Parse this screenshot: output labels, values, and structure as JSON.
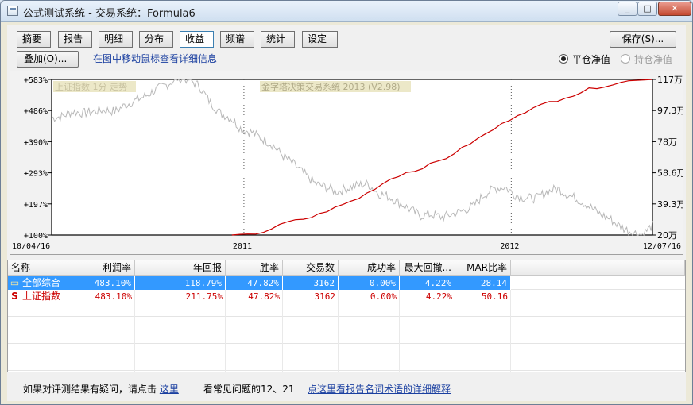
{
  "window": {
    "title": "公式测试系统 - 交易系统：Formula6",
    "min": "_",
    "max": "□",
    "close": "✕"
  },
  "tabs": [
    {
      "label": "摘要",
      "active": false
    },
    {
      "label": "报告",
      "active": false
    },
    {
      "label": "明细",
      "active": false
    },
    {
      "label": "分布",
      "active": false
    },
    {
      "label": "收益",
      "active": true
    },
    {
      "label": "频谱",
      "active": false
    },
    {
      "label": "统计",
      "active": false
    },
    {
      "label": "设定",
      "active": false
    }
  ],
  "toolbar": {
    "save_label": "保存(S)...",
    "overlay_label": "叠加(O)...",
    "hint": "在图中移动鼠标查看详细信息"
  },
  "mode": {
    "option1": "平仓净值",
    "option2": "持仓净值",
    "selected": "平仓净值"
  },
  "chart_data": {
    "type": "line",
    "watermark_left": "上证指数 1分 走势",
    "watermark_center": "金字塔决策交易系统 2013 (V2.98)",
    "left_ticks": [
      "+583%",
      "+486%",
      "+390%",
      "+293%",
      "+197%",
      "+100%"
    ],
    "right_ticks": [
      "117万",
      "97.3万",
      "78万",
      "58.6万",
      "39.3万",
      "20万"
    ],
    "x_start": "10/04/16",
    "x_end": "12/07/16",
    "x_markers": [
      "2011",
      "2012"
    ],
    "series": [
      {
        "color": "#cc0000",
        "values": [
          20,
          20,
          20,
          21,
          22,
          24,
          26,
          28,
          29,
          30,
          31,
          33,
          35,
          37,
          39,
          41,
          43,
          46,
          49,
          52,
          55,
          57,
          59,
          60,
          62,
          64,
          66,
          68,
          71,
          74,
          77,
          80,
          83,
          86,
          89,
          92,
          95,
          97,
          99,
          101,
          103,
          104,
          106,
          107,
          109,
          111,
          112,
          113,
          114,
          115,
          116,
          117,
          117,
          117
        ]
      },
      {
        "color": "#b8b8b8",
        "values": [
          93,
          94,
          97,
          96,
          97,
          98,
          97,
          101,
          104,
          107,
          111,
          114,
          118,
          117,
          113,
          103,
          96,
          93,
          86,
          84,
          80,
          76,
          69,
          64,
          58,
          52,
          50,
          47,
          49,
          51,
          52,
          46,
          44,
          40,
          36,
          32,
          33,
          31,
          33,
          35,
          38,
          45,
          49,
          50,
          45,
          43,
          43,
          47,
          49,
          45,
          42,
          38,
          33,
          30,
          25,
          22,
          20,
          26
        ]
      }
    ],
    "y_range": [
      20,
      117
    ]
  },
  "table": {
    "headers": [
      "名称",
      "利润率",
      "年回报",
      "胜率",
      "交易数",
      "成功率",
      "最大回撤...",
      "MAR比率"
    ],
    "rows": [
      {
        "icon": "folder-icon",
        "name": "全部综合",
        "profit": "483.10%",
        "annual": "118.79%",
        "win": "47.82%",
        "trades": "3162",
        "success": "0.00%",
        "drawdown": "4.22%",
        "mar": "28.14",
        "selected": true
      },
      {
        "icon": "s-icon",
        "iconText": "S",
        "name": "上证指数",
        "profit": "483.10%",
        "annual": "211.75%",
        "win": "47.82%",
        "trades": "3162",
        "success": "0.00%",
        "drawdown": "4.22%",
        "mar": "50.16",
        "selected": false
      }
    ]
  },
  "footer": {
    "text1": "如果对评测结果有疑问，请点击",
    "link1": "这里",
    "text2": "看常见问题的12、21",
    "link2": "点这里看报告名词术语的详细解释"
  },
  "colors": {
    "selected_row": "#3399ff",
    "red_text": "#cc0000",
    "link": "#1a3fa0"
  }
}
